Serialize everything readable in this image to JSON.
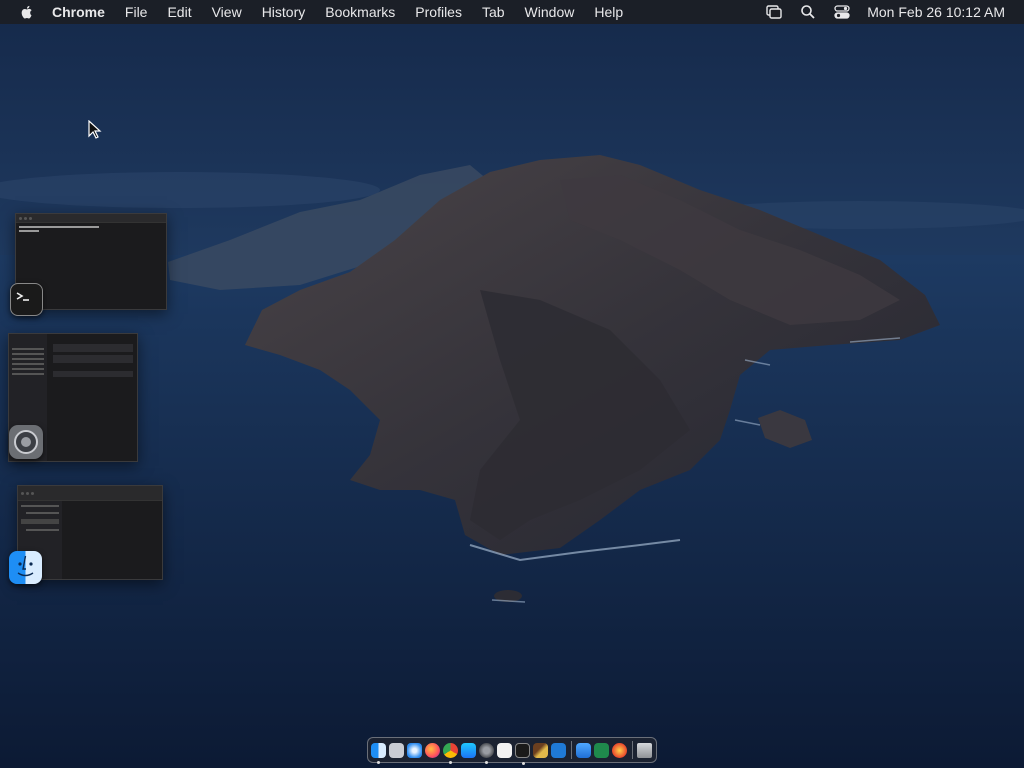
{
  "menubar": {
    "app_name": "Chrome",
    "menus": [
      "File",
      "Edit",
      "View",
      "History",
      "Bookmarks",
      "Profiles",
      "Tab",
      "Window",
      "Help"
    ],
    "clock": "Mon Feb 26  10:12 AM",
    "status_icons": [
      "screen-mirroring-icon",
      "search-icon",
      "control-center-icon"
    ]
  },
  "stage_manager": {
    "windows": [
      {
        "app": "Terminal",
        "icon": "terminal-icon"
      },
      {
        "app": "System Settings",
        "icon": "system-settings-icon"
      },
      {
        "app": "Finder",
        "icon": "finder-icon",
        "title": "Desktop"
      }
    ]
  },
  "dock": {
    "apps": [
      "Finder",
      "Launchpad",
      "Safari",
      "Firefox",
      "Chrome",
      "App Store",
      "System Settings",
      "TextEdit",
      "Terminal",
      "Paintbrush",
      "Visual Studio Code",
      "iCloud",
      "Excel",
      "Thunderbird"
    ],
    "trash": "Trash"
  },
  "colors": {
    "menubar_bg": "#1c1e24",
    "wallpaper_sky": "#1b3356",
    "wallpaper_sea": "#14284a"
  }
}
